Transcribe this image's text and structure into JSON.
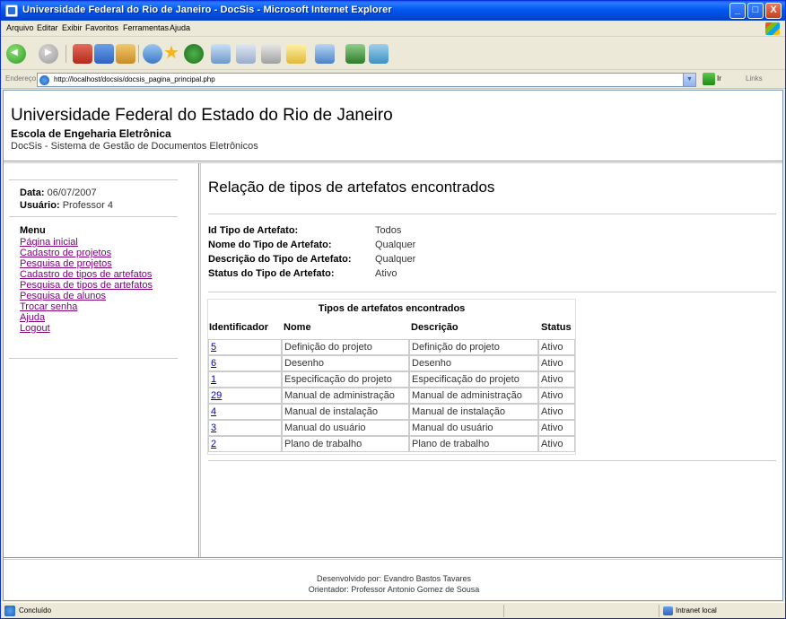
{
  "window": {
    "title": "Universidade Federal do Rio de Janeiro - DocSis - Microsoft Internet Explorer",
    "controls": {
      "minimize": "_",
      "maximize": "□",
      "close": "X"
    }
  },
  "menubar": [
    "Arquivo",
    "Editar",
    "Exibir",
    "Favoritos",
    "Ferramentas",
    "Ajuda"
  ],
  "address": {
    "label": "Endereço",
    "url": "http://localhost/docsis/docsis_pagina_principal.php",
    "go_label": "Ir",
    "links_label": "Links"
  },
  "header": {
    "title": "Universidade Federal do Estado do Rio de Janeiro",
    "subtitle": "Escola de Engeharia Eletrônica",
    "system": "DocSis - Sistema de Gestão de Documentos Eletrônicos"
  },
  "sidebar": {
    "date_label": "Data:",
    "date_value": "06/07/2007",
    "user_label": "Usuário:",
    "user_value": "Professor 4",
    "menu_title": "Menu",
    "links": [
      "Página inicial",
      "Cadastro de projetos",
      "Pesquisa de projetos",
      "Cadastro de tipos de artefatos",
      "Pesquisa de tipos de artefatos",
      "Pesquisa de alunos",
      "Trocar senha",
      "Ajuda",
      "Logout"
    ]
  },
  "main": {
    "title": "Relação de tipos de artefatos encontrados",
    "filters": [
      {
        "label": "Id Tipo de Artefato:",
        "value": "Todos"
      },
      {
        "label": "Nome do Tipo de Artefato:",
        "value": "Qualquer"
      },
      {
        "label": "Descrição do Tipo de Artefato:",
        "value": "Qualquer"
      },
      {
        "label": "Status do Tipo de Artefato:",
        "value": "Ativo"
      }
    ],
    "table": {
      "caption": "Tipos de artefatos encontrados",
      "headers": [
        "Identificador",
        "Nome",
        "Descrição",
        "Status"
      ],
      "rows": [
        {
          "id": "5",
          "nome": "Definição do projeto",
          "descricao": "Definição do projeto",
          "status": "Ativo"
        },
        {
          "id": "6",
          "nome": "Desenho",
          "descricao": "Desenho",
          "status": "Ativo"
        },
        {
          "id": "1",
          "nome": "Especificação do projeto",
          "descricao": "Especificação do projeto",
          "status": "Ativo"
        },
        {
          "id": "29",
          "nome": "Manual de administração",
          "descricao": "Manual de administração",
          "status": "Ativo"
        },
        {
          "id": "4",
          "nome": "Manual de instalação",
          "descricao": "Manual de instalação",
          "status": "Ativo"
        },
        {
          "id": "3",
          "nome": "Manual do usuário",
          "descricao": "Manual do usuário",
          "status": "Ativo"
        },
        {
          "id": "2",
          "nome": "Plano de trabalho",
          "descricao": "Plano de trabalho",
          "status": "Ativo"
        }
      ]
    }
  },
  "footer": {
    "line1": "Desenvolvido por: Evandro Bastos Tavares",
    "line2": "Orientador: Professor Antonio Gomez de Sousa"
  },
  "statusbar": {
    "text": "Concluído",
    "zone": "Intranet local"
  }
}
